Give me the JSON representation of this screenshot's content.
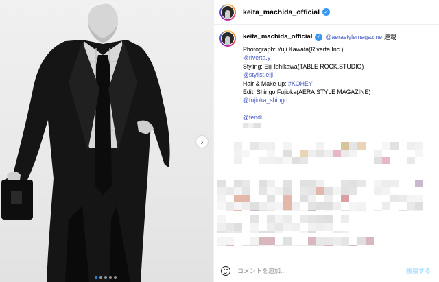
{
  "post": {
    "username": "keita_machida_official",
    "verified": true,
    "media": {
      "description_icon": "photo",
      "carousel_dots": 5,
      "active_dot": 1
    }
  },
  "caption": {
    "username": "keita_machida_official",
    "mention": "@aerastylemagazine",
    "tag": "連載",
    "lines": [
      {
        "text": "Photograph: Yuji Kawata(Riverta Inc.)",
        "type": "text"
      },
      {
        "text": "@riverta.y",
        "type": "link"
      },
      {
        "text": "Styling: Eiji Ishikawa(TABLE ROCK.STUDIO)",
        "type": "text"
      },
      {
        "text": "@stylist.eiji",
        "type": "link"
      },
      {
        "text": "Hair & Make-up: ",
        "type": "mixed",
        "link": "#KOHEY"
      },
      {
        "text": "Edit: Shingo Fujioka(AERA STYLE MAGAZINE)",
        "type": "text"
      },
      {
        "text": "@fujioka_shingo",
        "type": "link"
      },
      {
        "text": "",
        "type": "gap"
      },
      {
        "text": "@fendi",
        "type": "link"
      }
    ]
  },
  "comment_bar": {
    "placeholder": "コメントを追加...",
    "post_label": "投稿する"
  },
  "icons": {
    "verified": "verified-badge-icon",
    "next": "chevron-right-icon",
    "emoji": "emoji-icon"
  },
  "colors": {
    "link": "#4759c4",
    "verified": "#3897f0",
    "post_disabled": "#b2dffc"
  }
}
